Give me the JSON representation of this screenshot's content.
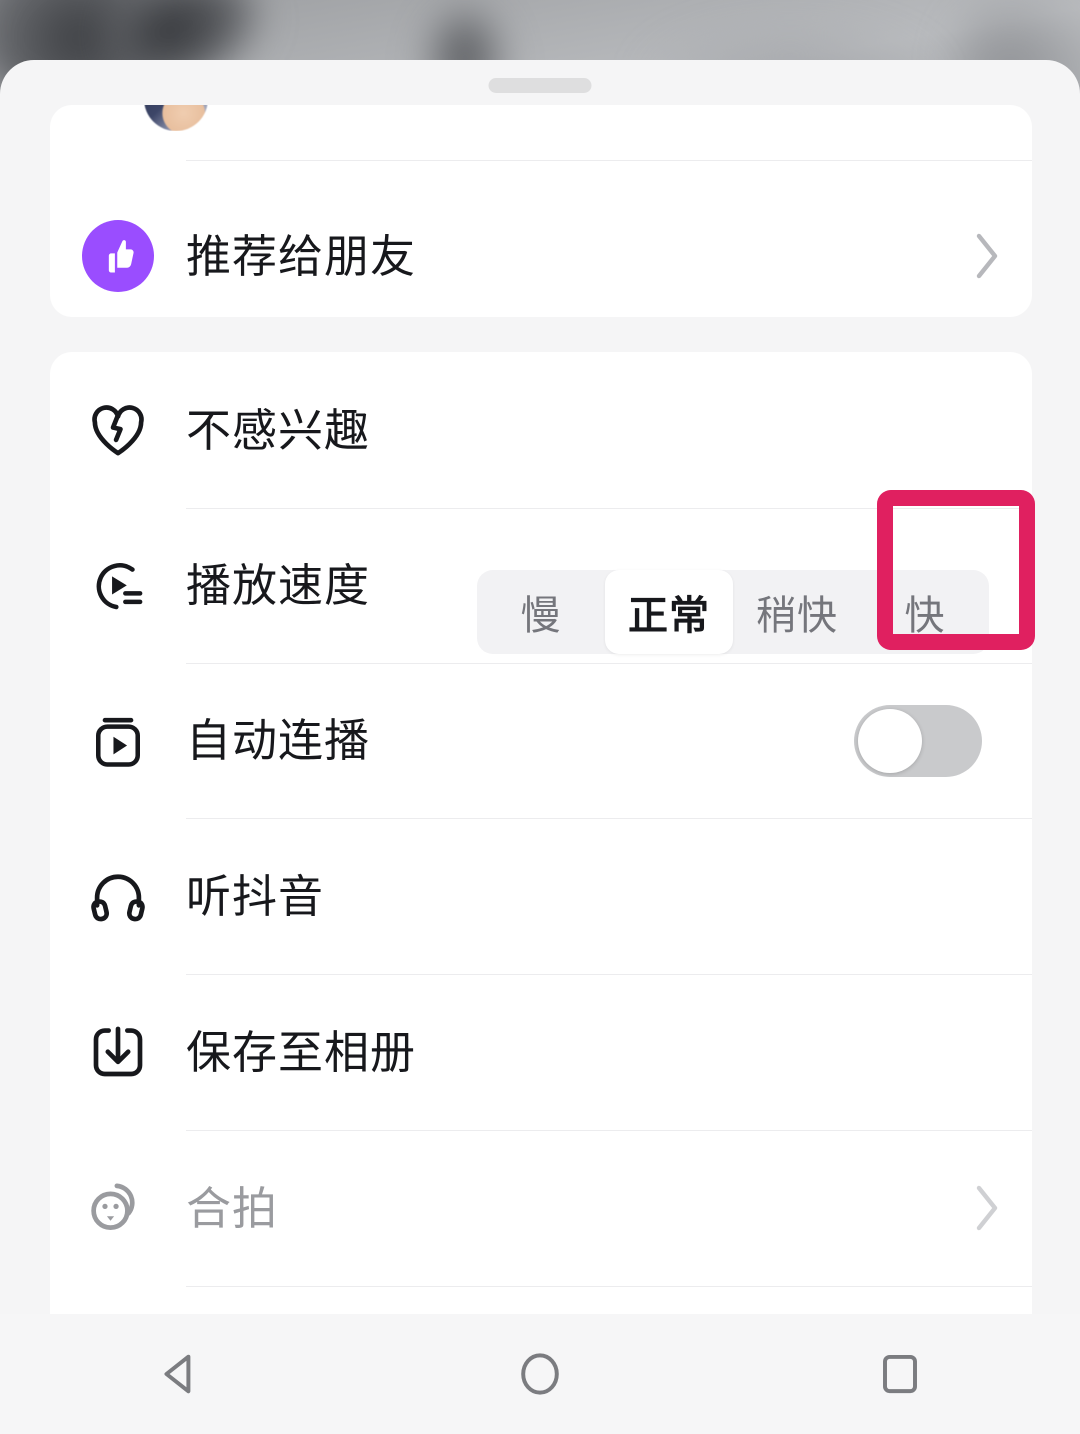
{
  "sheet": {
    "drag_handle": "drag-handle"
  },
  "share_card": {
    "rows": [
      {
        "id": "recommend-to-friends",
        "label": "推荐给朋友",
        "icon": "thumbs-up-icon",
        "accent": "#9a4dff",
        "accessory": "chevron-right-icon"
      }
    ]
  },
  "actions_card": {
    "rows": [
      {
        "id": "not-interested",
        "label": "不感兴趣",
        "icon": "broken-heart-icon"
      },
      {
        "id": "playback-speed",
        "label": "播放速度",
        "icon": "play-speed-icon"
      },
      {
        "id": "auto-play",
        "label": "自动连播",
        "icon": "auto-play-icon",
        "toggle_state": "off"
      },
      {
        "id": "listen-douyin",
        "label": "听抖音",
        "icon": "headphones-icon"
      },
      {
        "id": "save-to-album",
        "label": "保存至相册",
        "icon": "download-icon"
      },
      {
        "id": "duet",
        "label": "合拍",
        "icon": "duet-icon",
        "disabled": true,
        "accessory": "chevron-right-icon"
      }
    ]
  },
  "playback_speed": {
    "options": [
      {
        "id": "slow",
        "label": "慢",
        "selected": false
      },
      {
        "id": "normal",
        "label": "正常",
        "selected": true
      },
      {
        "id": "slightly-fast",
        "label": "稍快",
        "selected": false
      },
      {
        "id": "fast",
        "label": "快",
        "selected": false
      }
    ],
    "selected_label": "正常",
    "highlight": {
      "target_label": "快",
      "color": "#e02060"
    }
  },
  "navbar": {
    "buttons": [
      {
        "id": "back",
        "icon": "back-triangle-icon"
      },
      {
        "id": "home",
        "icon": "home-circle-icon"
      },
      {
        "id": "recents",
        "icon": "recents-square-icon"
      }
    ]
  },
  "colors": {
    "sheet_bg": "#f5f5f6",
    "card_bg": "#ffffff",
    "text": "#17181c",
    "text_dim": "#9a9b9f",
    "divider": "#ececee",
    "seg_track": "#f2f2f4",
    "toggle_off": "#c9cacc",
    "highlight": "#e02060",
    "purple": "#9a4dff"
  }
}
